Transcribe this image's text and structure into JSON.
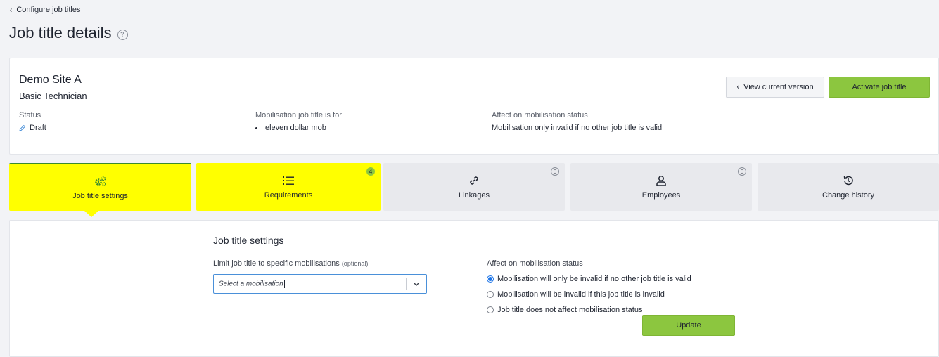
{
  "breadcrumb": {
    "label": "Configure job titles"
  },
  "page": {
    "title": "Job title details"
  },
  "summary": {
    "site": "Demo Site A",
    "job_title": "Basic Technician",
    "status_label": "Status",
    "status_value": "Draft",
    "mob_label": "Mobilisation job title is for",
    "mob_value": "eleven dollar mob",
    "affect_label": "Affect on mobilisation status",
    "affect_value": "Mobilisation only invalid if no other job title is valid",
    "view_button": "View current version",
    "activate_button": "Activate job title"
  },
  "tabs": [
    {
      "label": "Job title settings",
      "icon": "gears-icon",
      "badge": ""
    },
    {
      "label": "Requirements",
      "icon": "list-icon",
      "badge": "4"
    },
    {
      "label": "Linkages",
      "icon": "link-icon",
      "badge": "0"
    },
    {
      "label": "Employees",
      "icon": "person-icon",
      "badge": "0"
    },
    {
      "label": "Change history",
      "icon": "history-icon",
      "badge": ""
    }
  ],
  "settings": {
    "title": "Job title settings",
    "limit_label": "Limit job title to specific mobilisations",
    "limit_optional": "(optional)",
    "select_placeholder": "Select a mobilisation",
    "affect_label": "Affect on mobilisation status",
    "options": [
      {
        "label": "Mobilisation will only be invalid if no other job title is valid",
        "selected": true
      },
      {
        "label": "Mobilisation will be invalid if this job title is invalid",
        "selected": false
      },
      {
        "label": "Job title does not affect mobilisation status",
        "selected": false
      }
    ],
    "update_button": "Update"
  },
  "colors": {
    "accent_green": "#8cc63f",
    "highlight_yellow": "#ffff00",
    "radio_blue": "#1a73e8"
  }
}
